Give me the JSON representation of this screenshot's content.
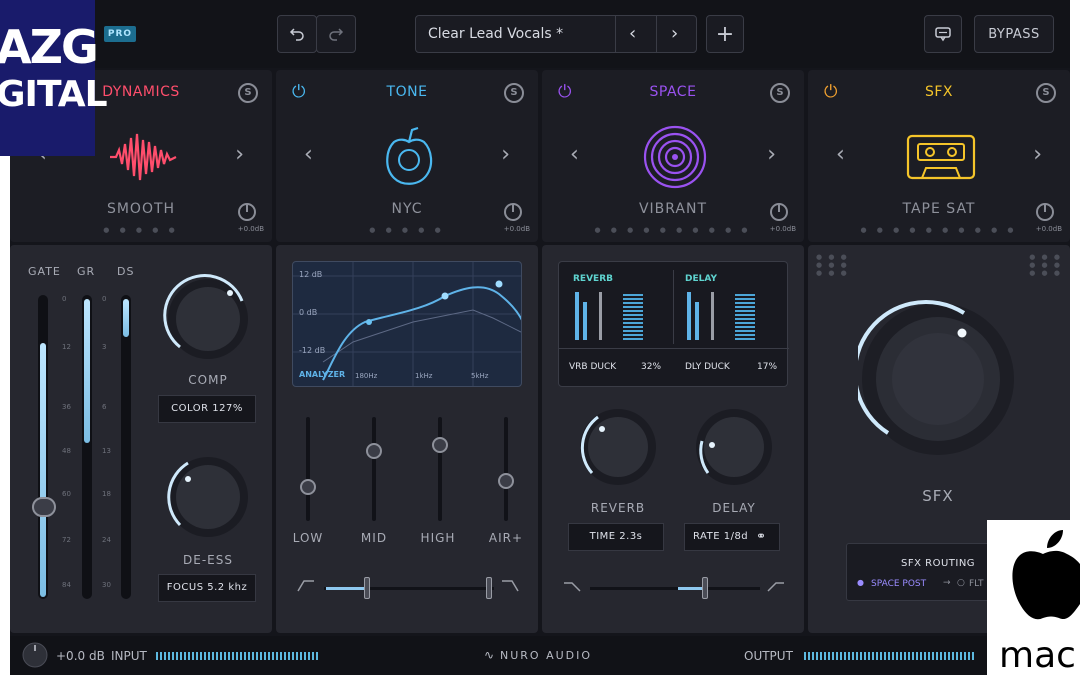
{
  "topbar": {
    "pro_badge": "PRO",
    "undo_icon": "undo-icon",
    "redo_icon": "redo-icon",
    "preset_name": "Clear Lead Vocals *",
    "add_icon": "plus-icon",
    "feedback_icon": "chat-icon",
    "bypass_label": "BYPASS"
  },
  "modules": [
    {
      "title": "DYNAMICS",
      "preset": "SMOOTH",
      "gain": "+0.0dB",
      "color": "#ff4e6c",
      "icon": "waveform-icon"
    },
    {
      "title": "TONE",
      "preset": "NYC",
      "gain": "+0.0dB",
      "color": "#4ab8f0",
      "icon": "apple-core-icon"
    },
    {
      "title": "SPACE",
      "preset": "VIBRANT",
      "gain": "+0.0dB",
      "color": "#9a52f0",
      "icon": "spiral-icon"
    },
    {
      "title": "SFX",
      "preset": "TAPE SAT",
      "gain": "+0.0dB",
      "color": "#f5c52a",
      "icon": "cassette-icon"
    }
  ],
  "dynamics": {
    "meter_labels": [
      "GATE",
      "GR",
      "DS"
    ],
    "scale_left": [
      "0",
      "12",
      "36",
      "48",
      "60",
      "72",
      "84"
    ],
    "scale_right": [
      "0",
      "3",
      "6",
      "13",
      "18",
      "24",
      "30"
    ],
    "comp_label": "COMP",
    "color_readout": "COLOR  127%",
    "deess_label": "DE-ESS",
    "focus_readout": "FOCUS  5.2 khz"
  },
  "tone": {
    "db_top": "12 dB",
    "db_mid": "0 dB",
    "db_bottom": "-12 dB",
    "analyzer_label": "ANALYZER",
    "freq_labels": [
      "180Hz",
      "1kHz",
      "5kHz"
    ],
    "band_labels": [
      "LOW",
      "MID",
      "HIGH",
      "AIR+"
    ]
  },
  "space": {
    "reverb_title": "REVERB",
    "delay_title": "DELAY",
    "vrb_duck": "VRB DUCK",
    "vrb_duck_value": "32%",
    "dly_duck": "DLY DUCK",
    "dly_duck_value": "17%",
    "reverb_label": "REVERB",
    "delay_label": "DELAY",
    "time_readout": "TIME  2.3s",
    "rate_readout": "RATE  1/8d"
  },
  "sfx": {
    "knob_label": "SFX",
    "routing_title": "SFX ROUTING",
    "routing_value": "SPACE POST",
    "routing_alt": "FLT"
  },
  "bottombar": {
    "input_gain": "+0.0 dB",
    "input_label": "INPUT",
    "brand": "NURO AUDIO",
    "output_label": "OUTPUT"
  },
  "overlays": {
    "azg_line1": "AZG",
    "azg_line2": "GITAL",
    "mac_text": "mac"
  }
}
